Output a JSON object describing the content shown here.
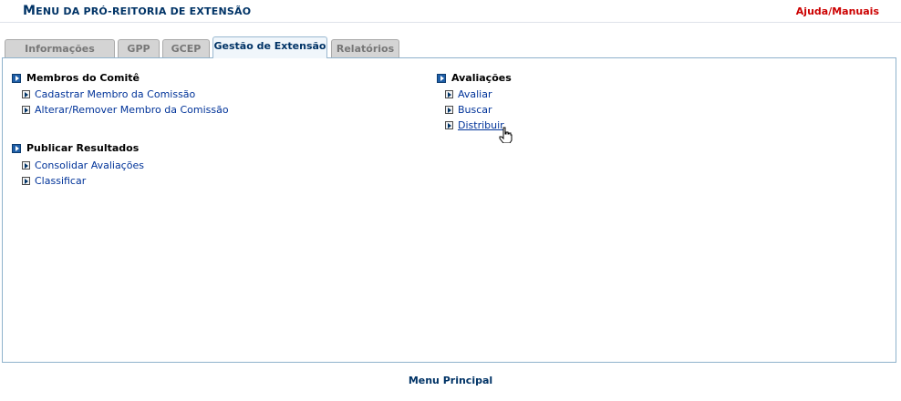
{
  "header": {
    "title_prefix": "M",
    "title_rest": "enu da Pró-Reitoria de Extensão",
    "help_link": "Ajuda/Manuais"
  },
  "tabs": [
    {
      "label": "Informações Gerais",
      "active": false
    },
    {
      "label": "GPP",
      "active": false
    },
    {
      "label": "GCEP",
      "active": false
    },
    {
      "label": "Gestão de Extensão",
      "active": true
    },
    {
      "label": "Relatórios",
      "active": false
    }
  ],
  "sections": {
    "membros": {
      "title": "Membros do Comitê",
      "items": [
        "Cadastrar Membro da Comissão",
        "Alterar/Remover Membro da Comissão"
      ]
    },
    "publicar": {
      "title": "Publicar Resultados",
      "items": [
        "Consolidar Avaliações",
        "Classificar"
      ]
    },
    "avaliacoes": {
      "title": "Avaliações",
      "items": [
        "Avaliar",
        "Buscar",
        "Distribuir"
      ]
    }
  },
  "footer": {
    "menu_principal": "Menu Principal"
  }
}
